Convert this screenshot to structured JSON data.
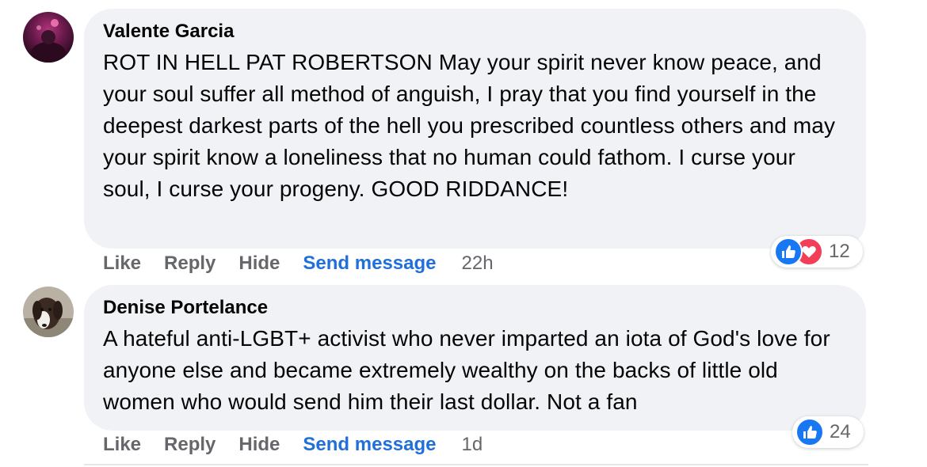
{
  "comments": [
    {
      "author": "Valente Garcia",
      "text": "ROT IN HELL PAT ROBERTSON May your spirit never know peace, and your soul suffer all method of anguish, I pray that you find yourself in the deepest darkest parts of the hell you prescribed countless others and may your spirit know a loneliness that no human could fathom. I curse your soul, I curse your progeny. GOOD RIDDANCE!",
      "actions": {
        "like": "Like",
        "reply": "Reply",
        "hide": "Hide",
        "send_message": "Send message"
      },
      "timestamp": "22h",
      "reactions": {
        "types": [
          "like-icon",
          "love-icon"
        ],
        "count": "12"
      },
      "avatar": {
        "icon": "avatar"
      }
    },
    {
      "author": "Denise Portelance",
      "text": "A hateful anti-LGBT+ activist who never imparted an iota of God's love for anyone else and became extremely wealthy on the backs of little old women who would send him their last dollar. Not a fan",
      "actions": {
        "like": "Like",
        "reply": "Reply",
        "hide": "Hide",
        "send_message": "Send message"
      },
      "timestamp": "1d",
      "reactions": {
        "types": [
          "like-icon"
        ],
        "count": "24"
      },
      "avatar": {
        "icon": "avatar"
      }
    }
  ],
  "colors": {
    "bubble": "#f0f2f5",
    "action_text": "#65676b",
    "send_message": "#216fdb",
    "like_blue": "#1877f2",
    "love_red": "#f33e58"
  }
}
